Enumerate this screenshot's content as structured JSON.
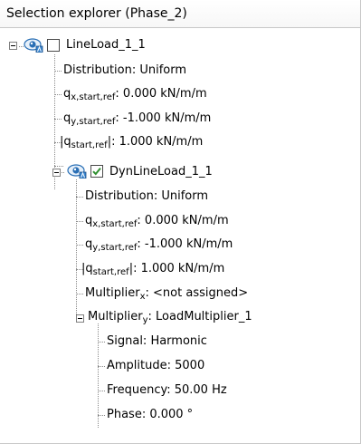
{
  "panel": {
    "title": "Selection explorer (Phase_2)"
  },
  "tree": {
    "lineload": {
      "name": "LineLoad_1_1",
      "checked": false,
      "distribution": "Distribution: Uniform",
      "qx_symbol": "q",
      "qx_sub": "x,start,ref",
      "qx_value": ": 0.000 kN/m/m",
      "qy_symbol": "q",
      "qy_sub": "y,start,ref",
      "qy_value": ": -1.000 kN/m/m",
      "qabs_prefix": "|q",
      "qabs_sub": "start,ref",
      "qabs_value": "|: 1.000 kN/m/m"
    },
    "dynlineload": {
      "name": "DynLineLoad_1_1",
      "checked": true,
      "distribution": "Distribution: Uniform",
      "qx_symbol": "q",
      "qx_sub": "x,start,ref",
      "qx_value": ": 0.000 kN/m/m",
      "qy_symbol": "q",
      "qy_sub": "y,start,ref",
      "qy_value": ": -1.000 kN/m/m",
      "qabs_prefix": "|q",
      "qabs_sub": "start,ref",
      "qabs_value": "|: 1.000 kN/m/m",
      "mx_symbol": "Multiplier",
      "mx_sub": "x",
      "mx_value": ": <not assigned>",
      "my_symbol": "Multiplier",
      "my_sub": "y",
      "my_value": ": LoadMultiplier_1",
      "multiplier": {
        "signal": "Signal: Harmonic",
        "amplitude": "Amplitude: 5000",
        "frequency": "Frequency: 50.00 Hz",
        "phase": "Phase: 0.000 °"
      }
    }
  },
  "colors": {
    "eye_blue": "#2a6fb5",
    "check_green": "#2f8f2f",
    "tree_line": "#8a8a8a"
  }
}
